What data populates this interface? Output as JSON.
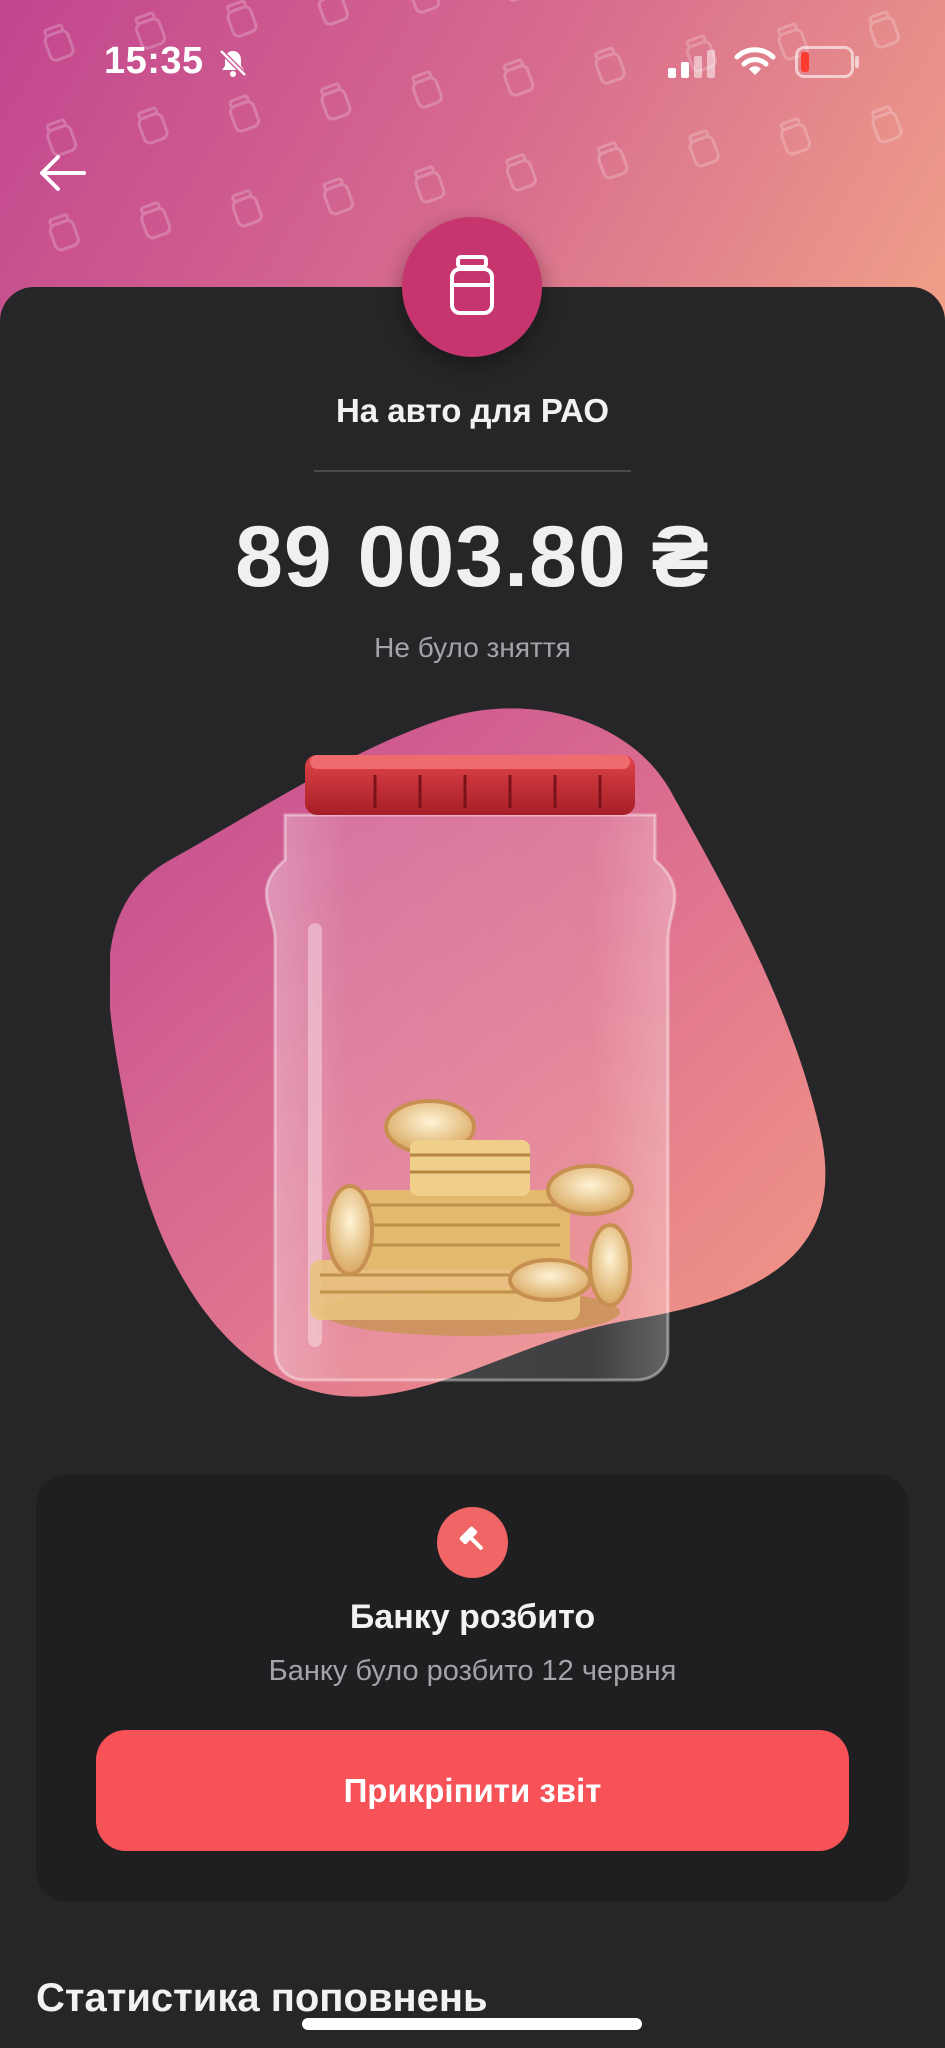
{
  "status_bar": {
    "time": "15:35",
    "icons": [
      "bell-off-icon",
      "cellular-signal-icon",
      "wifi-icon",
      "battery-low-icon"
    ]
  },
  "nav": {
    "back_icon": "arrow-left-icon"
  },
  "jar": {
    "icon": "jar-icon",
    "title": "На авто для РАО",
    "amount": "89 003.80 ₴",
    "withdraw_status": "Не було зняття"
  },
  "status_card": {
    "icon": "hammer-icon",
    "title": "Банку розбито",
    "subtitle": "Банку було розбито 12 червня",
    "attach_button": "Прикріпити звіт"
  },
  "stats": {
    "heading": "Статистика поповнень"
  },
  "colors": {
    "accent": "#f65258",
    "badge": "#c7356e",
    "background": "#262628",
    "card": "#1f1f21"
  }
}
